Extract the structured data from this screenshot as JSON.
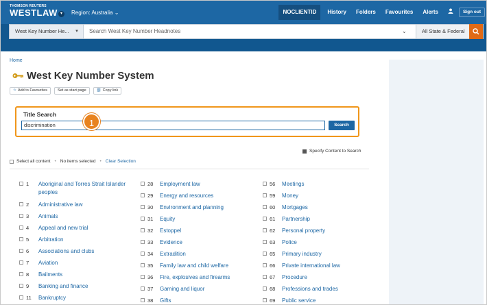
{
  "header": {
    "brand_small": "THOMSON REUTERS",
    "brand_main": "WESTLAW",
    "region": "Region: Australia",
    "nav": [
      "NOCLIENTID",
      "History",
      "Folders",
      "Favourites",
      "Alerts"
    ],
    "signout": "Sign out"
  },
  "search": {
    "scope": "West Key Number He...",
    "placeholder": "Search West Key Number Headnotes",
    "jurisdiction": "All State & Federal"
  },
  "breadcrumb": "Home",
  "page_title": "West Key Number System",
  "actions": {
    "favourites": "Add to Favourites",
    "start_page": "Set as start page",
    "copy_link": "Copy link"
  },
  "title_search": {
    "label": "Title Search",
    "value": "discrimination",
    "button": "Search",
    "callout": "1"
  },
  "specify": "Specify Content to Search",
  "selection": {
    "select_all": "Select all content",
    "status": "No items selected",
    "clear": "Clear Selection"
  },
  "topics": {
    "col1": [
      {
        "num": "1",
        "label": "Aboriginal and Torres Strait Islander peoples"
      },
      {
        "num": "2",
        "label": "Administrative law"
      },
      {
        "num": "3",
        "label": "Animals"
      },
      {
        "num": "4",
        "label": "Appeal and new trial"
      },
      {
        "num": "5",
        "label": "Arbitration"
      },
      {
        "num": "6",
        "label": "Associations and clubs"
      },
      {
        "num": "7",
        "label": "Aviation"
      },
      {
        "num": "8",
        "label": "Bailments"
      },
      {
        "num": "9",
        "label": "Banking and finance"
      },
      {
        "num": "11",
        "label": "Bankruptcy"
      }
    ],
    "col2": [
      {
        "num": "28",
        "label": "Employment law"
      },
      {
        "num": "29",
        "label": "Energy and resources"
      },
      {
        "num": "30",
        "label": "Environment and planning"
      },
      {
        "num": "31",
        "label": "Equity"
      },
      {
        "num": "32",
        "label": "Estoppel"
      },
      {
        "num": "33",
        "label": "Evidence"
      },
      {
        "num": "34",
        "label": "Extradition"
      },
      {
        "num": "35",
        "label": "Family law and child welfare"
      },
      {
        "num": "36",
        "label": "Fire, explosives and firearms"
      },
      {
        "num": "37",
        "label": "Gaming and liquor"
      },
      {
        "num": "38",
        "label": "Gifts"
      }
    ],
    "col3": [
      {
        "num": "56",
        "label": "Meetings"
      },
      {
        "num": "59",
        "label": "Money"
      },
      {
        "num": "60",
        "label": "Mortgages"
      },
      {
        "num": "61",
        "label": "Partnership"
      },
      {
        "num": "62",
        "label": "Personal property"
      },
      {
        "num": "63",
        "label": "Police"
      },
      {
        "num": "65",
        "label": "Primary industry"
      },
      {
        "num": "66",
        "label": "Private international law"
      },
      {
        "num": "67",
        "label": "Procedure"
      },
      {
        "num": "68",
        "label": "Professions and trades"
      },
      {
        "num": "69",
        "label": "Public service"
      }
    ]
  },
  "colors": {
    "brand_blue": "#1d67a4",
    "accent_orange": "#e06a15",
    "highlight": "#f0961a"
  }
}
